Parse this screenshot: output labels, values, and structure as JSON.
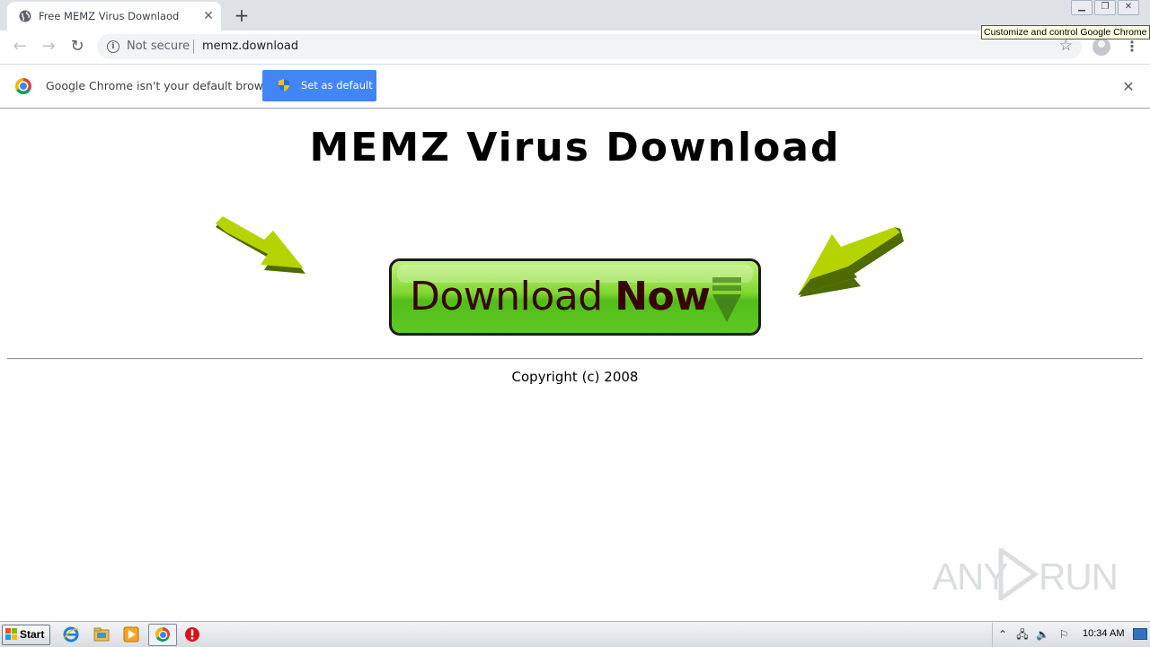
{
  "browser": {
    "tab_title": "Free MEMZ Virus Downlaod",
    "tab_close": "✕",
    "new_tab": "+",
    "security_label": "Not secure",
    "url": "memz.download",
    "tooltip": "Customize and control Google Chrome",
    "menu_glyph": "⋮",
    "bookmark_glyph": "☆"
  },
  "infobar": {
    "message": "Google Chrome isn't your default browser",
    "button_label": "Set as default",
    "close_glyph": "✕"
  },
  "page": {
    "heading": "MEMZ Virus Download",
    "download_button": {
      "regular": "Download ",
      "bold": "Now"
    },
    "copyright": "Copyright (c) 2008"
  },
  "watermark": {
    "left": "ANY",
    "right": "RUN"
  },
  "taskbar": {
    "start_label": "Start",
    "clock": "10:34 AM",
    "pinned": [
      "internet-explorer-icon",
      "file-explorer-icon",
      "media-player-icon",
      "chrome-icon",
      "stop-icon"
    ]
  },
  "colors": {
    "button_green": "#52bc1a",
    "arrow_light": "#b5d300",
    "arrow_dark": "#4e6a00",
    "infobar_button": "#4285f4"
  }
}
